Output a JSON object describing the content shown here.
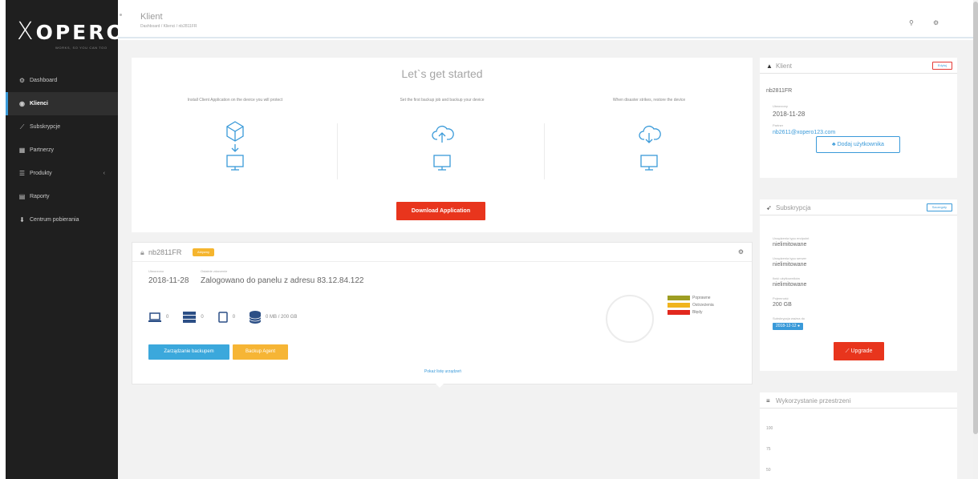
{
  "sidebar": {
    "logo_text": "OPERO",
    "logo_mark": "X",
    "tagline": "WORKS, SO YOU CAN TOO",
    "items": [
      {
        "label": "Dashboard",
        "icon": "dashboard-icon"
      },
      {
        "label": "Klienci",
        "icon": "user-icon",
        "active": true
      },
      {
        "label": "Subskrypcje",
        "icon": "chart-icon"
      },
      {
        "label": "Partnerzy",
        "icon": "partners-icon"
      },
      {
        "label": "Produkty",
        "icon": "products-icon",
        "has_submenu": true
      },
      {
        "label": "Raporty",
        "icon": "reports-icon"
      },
      {
        "label": "Centrum pobierania",
        "icon": "download-center-icon"
      }
    ]
  },
  "topbar": {
    "title": "Klient",
    "breadcrumb": "Dashboard / Klienci / nb2811FR"
  },
  "start": {
    "title": "Let`s get started",
    "steps": [
      {
        "text": "Install Client Application on the device you will protect"
      },
      {
        "text": "Set the first backup job and backup your device"
      },
      {
        "text": "When disaster strikes, restore the device"
      }
    ],
    "download_label": "Download Application"
  },
  "device": {
    "name": "nb2811FR",
    "badge": "Aktywny",
    "created_label": "Utworzono",
    "created_value": "2018-11-28",
    "last_event_label": "Ostatnie zdarzenie",
    "last_event_value": "Zalogowano do panelu z adresu 83.12.84.122",
    "counts": {
      "laptops": "0",
      "servers": "0",
      "mobiles": "0",
      "storage": "0 MB / 200 GB"
    },
    "manage_btn": "Zarządzanie backupem",
    "agent_btn": "Backup Agent",
    "more_link": "Pokaż listę urządzeń",
    "legend": [
      {
        "label": "Poprawne",
        "color": "#9e9e23"
      },
      {
        "label": "Ostrzeżenia",
        "color": "#f0b41e"
      },
      {
        "label": "Błędy",
        "color": "#e2281e"
      }
    ]
  },
  "client_panel": {
    "title": "Klient",
    "edit_btn": "Edytuj",
    "name": "nb2811FR",
    "created_label": "Utworzony",
    "created_value": "2018-11-28",
    "partner_label": "Partner",
    "partner_value": "nb2611@xopero123.com",
    "add_user_btn": "Dodaj użytkownika"
  },
  "subscription_panel": {
    "title": "Subskrypcja",
    "change_btn": "Szczegóły",
    "rows": [
      {
        "label": "Urządzenia typu endpoint",
        "value": "nielimitowane"
      },
      {
        "label": "Urządzenia typu serwer",
        "value": "nielimitowane"
      },
      {
        "label": "Ilość użytkowników",
        "value": "nielimitowane"
      },
      {
        "label": "Pojemność",
        "value": "200 GB"
      }
    ],
    "valid_label": "Subskrypcja ważna do",
    "valid_value": "2018-12-12",
    "upgrade_btn": "Upgrade"
  },
  "storage_panel": {
    "title": "Wykorzystanie przestrzeni",
    "ticks": [
      "100",
      "75",
      "50"
    ]
  },
  "colors": {
    "sidebar_bg": "#1f1f1f",
    "accent": "#3a9ad9",
    "danger": "#e8351d",
    "warning": "#f6b535"
  }
}
